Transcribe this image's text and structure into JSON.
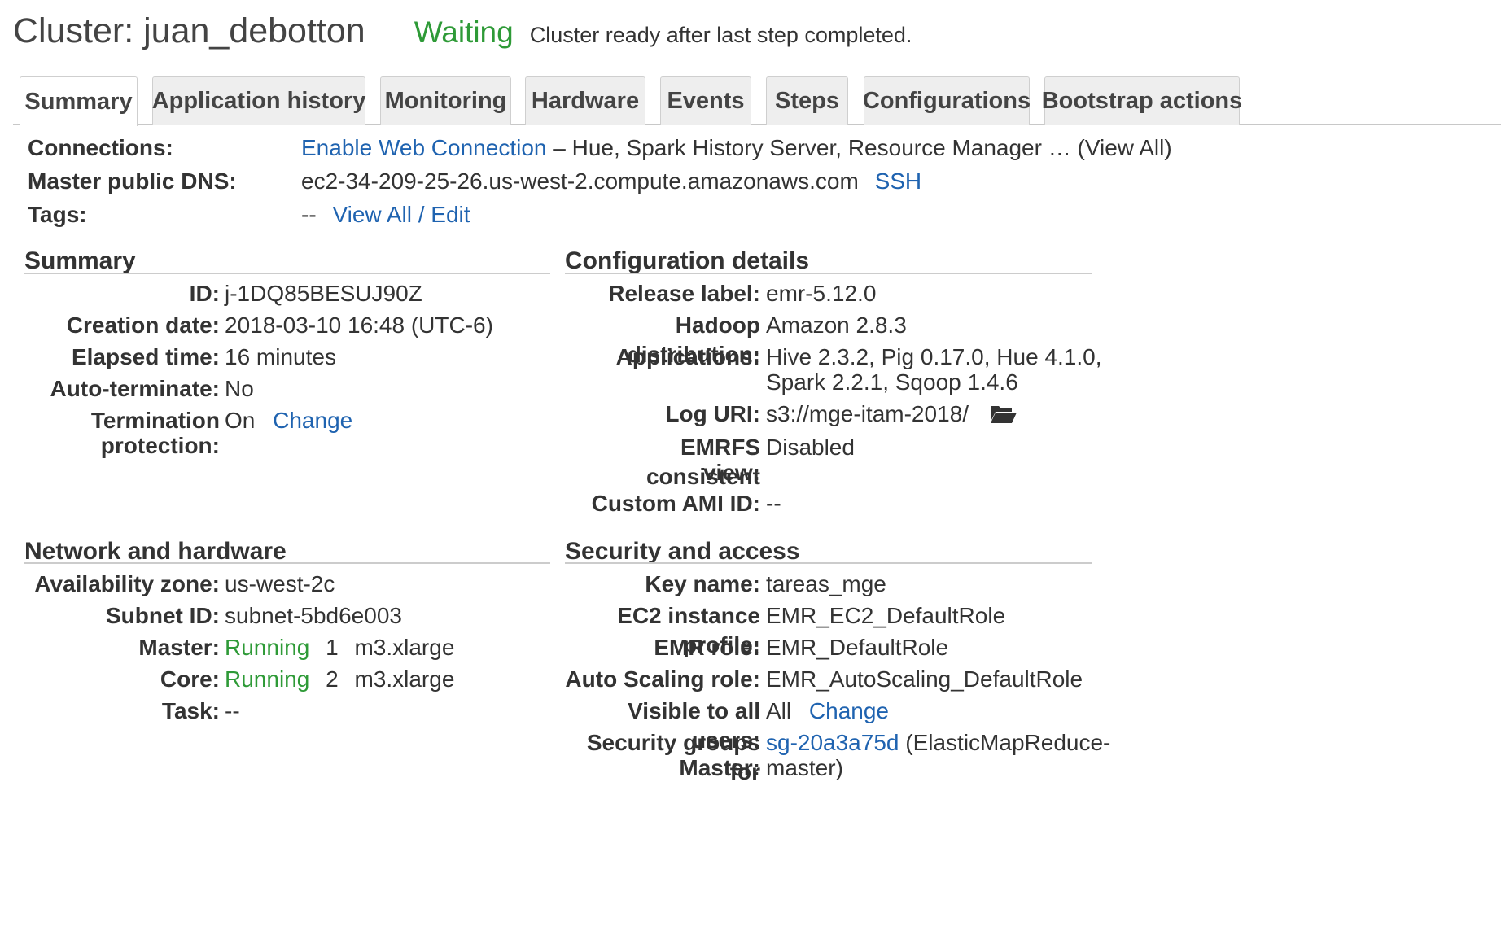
{
  "header": {
    "title": "Cluster: juan_debotton",
    "status": "Waiting",
    "status_message": "Cluster ready after last step completed.",
    "status_color": "#2e9a37"
  },
  "tabs": [
    {
      "label": "Summary",
      "active": true
    },
    {
      "label": "Application history"
    },
    {
      "label": "Monitoring"
    },
    {
      "label": "Hardware"
    },
    {
      "label": "Events"
    },
    {
      "label": "Steps"
    },
    {
      "label": "Configurations"
    },
    {
      "label": "Bootstrap actions"
    }
  ],
  "connections": {
    "label": "Connections:",
    "link": "Enable Web Connection",
    "rest": " – Hue, Spark History Server, Resource Manager … (View All)"
  },
  "dns": {
    "label": "Master public DNS:",
    "value": "ec2-34-209-25-26.us-west-2.compute.amazonaws.com",
    "ssh": "SSH"
  },
  "tags": {
    "label": "Tags:",
    "value": "--",
    "link": "View All / Edit"
  },
  "summary": {
    "title": "Summary",
    "id_label": "ID:",
    "id": "j-1DQ85BESUJ90Z",
    "creation_label": "Creation date:",
    "creation": "2018-03-10 16:48 (UTC-6)",
    "elapsed_label": "Elapsed time:",
    "elapsed": "16 minutes",
    "autoterm_label": "Auto-terminate:",
    "autoterm": "No",
    "termprot_label_1": "Termination",
    "termprot_label_2": "protection:",
    "termprot": "On",
    "termprot_link": "Change"
  },
  "config": {
    "title": "Configuration details",
    "release_label": "Release label:",
    "release": "emr-5.12.0",
    "hadoop_label": "Hadoop distribution:",
    "hadoop": "Amazon 2.8.3",
    "apps_label": "Applications:",
    "apps_1": "Hive 2.3.2, Pig 0.17.0, Hue 4.1.0,",
    "apps_2": "Spark 2.2.1, Sqoop 1.4.6",
    "log_label": "Log URI:",
    "log": "s3://mge-itam-2018/",
    "emrfs_label_1": "EMRFS consistent",
    "emrfs_label_2": "view:",
    "emrfs": "Disabled",
    "ami_label": "Custom AMI ID:",
    "ami": "--"
  },
  "network": {
    "title": "Network and hardware",
    "az_label": "Availability zone:",
    "az": "us-west-2c",
    "subnet_label": "Subnet ID:",
    "subnet": "subnet-5bd6e003",
    "master_label": "Master:",
    "master_status": "Running",
    "master_count": "1",
    "master_type": "m3.xlarge",
    "core_label": "Core:",
    "core_status": "Running",
    "core_count": "2",
    "core_type": "m3.xlarge",
    "task_label": "Task:",
    "task": "--"
  },
  "security": {
    "title": "Security and access",
    "key_label": "Key name:",
    "key": "tareas_mge",
    "profile_label": "EC2 instance profile:",
    "profile": "EMR_EC2_DefaultRole",
    "role_label": "EMR role:",
    "role": "EMR_DefaultRole",
    "asrole_label": "Auto Scaling role:",
    "asrole": "EMR_AutoScaling_DefaultRole",
    "visible_label": "Visible to all users:",
    "visible": "All",
    "visible_link": "Change",
    "sg_label_1": "Security groups for",
    "sg_label_2": "Master:",
    "sg_link": "sg-20a3a75d",
    "sg_rest_1": " (ElasticMapReduce-",
    "sg_rest_2": "master)"
  }
}
